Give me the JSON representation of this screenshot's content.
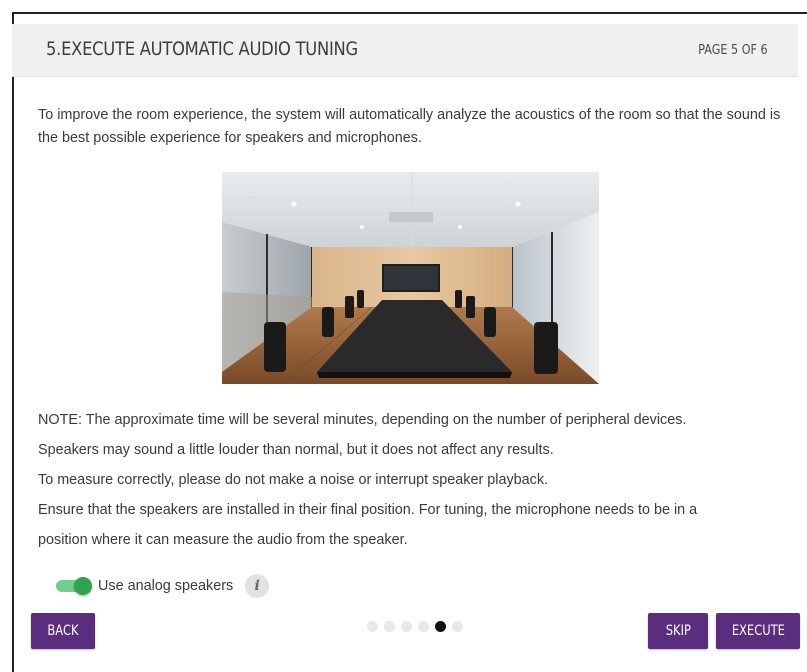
{
  "header": {
    "title": "5.EXECUTE AUTOMATIC AUDIO TUNING",
    "page_indicator": "PAGE 5 OF 6"
  },
  "intro_text": "To improve the room experience, the system will automatically analyze the acoustics of the room so that the sound is the best possible experience for speakers and microphones.",
  "notes": [
    "NOTE: The approximate time will be several minutes, depending on the number of peripheral devices.",
    "Speakers may sound a little louder than normal, but it does not affect any results.",
    "To measure correctly, please do not make a noise or interrupt speaker playback.",
    "Ensure that the speakers are installed in their final position. For tuning, the microphone needs to be in a",
    "position where it can measure the audio from the speaker."
  ],
  "toggle": {
    "label": "Use analog speakers",
    "checked": true,
    "color": "#2ea44f"
  },
  "info_icon": "info-icon",
  "pagination": {
    "total": 6,
    "current": 5
  },
  "buttons": {
    "back": "BACK",
    "skip": "SKIP",
    "execute": "EXECUTE"
  },
  "colors": {
    "accent": "#5b2d7e",
    "header_bg": "#f0f0f0"
  }
}
